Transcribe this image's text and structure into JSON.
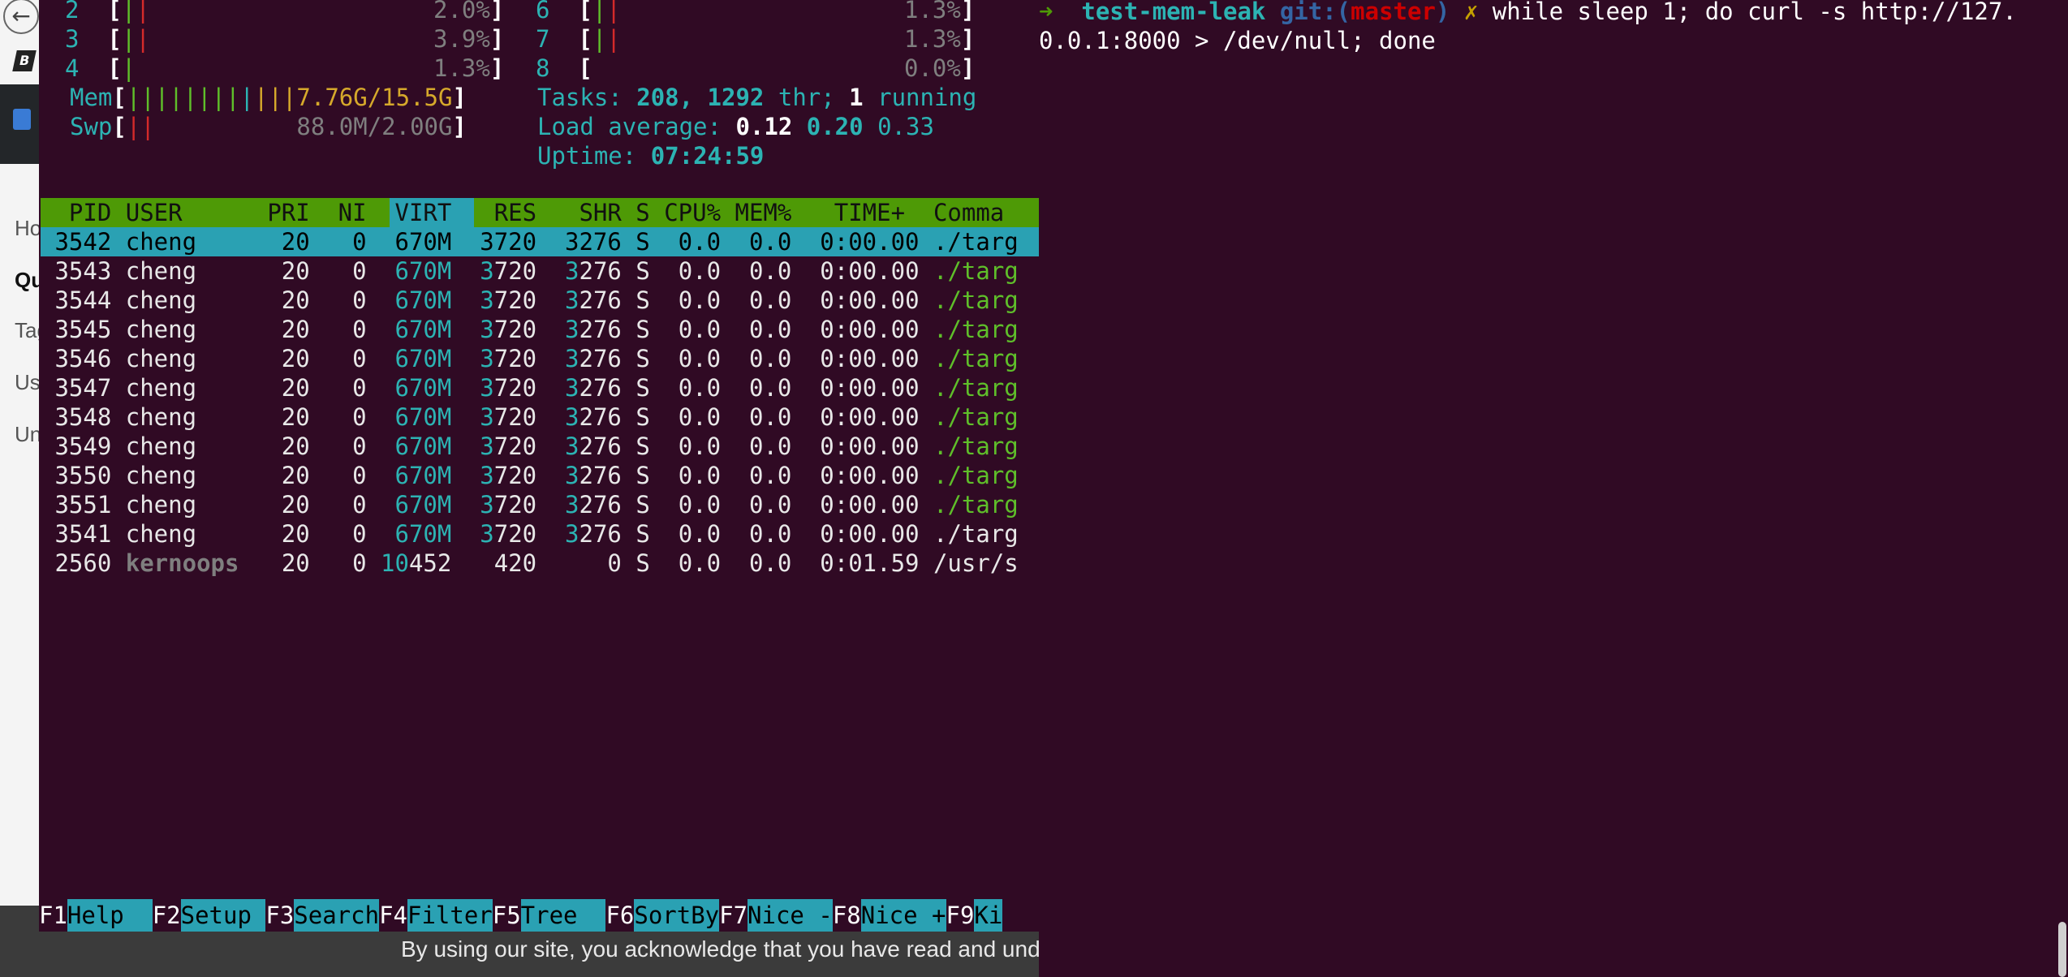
{
  "bg_page": {
    "back_glyph": "←",
    "logo_glyph": "B",
    "nav": [
      "Ho",
      "Qu",
      "Tag",
      "Us",
      "Un"
    ],
    "cookie_text": "By using our site, you acknowledge that you have read and understan"
  },
  "htop": {
    "cpus": [
      {
        "num": "2",
        "bars": "||",
        "pct": "2.0%"
      },
      {
        "num": "3",
        "bars": "||",
        "pct": "3.9%"
      },
      {
        "num": "4",
        "bars": "|",
        "pct": "1.3%"
      },
      {
        "num": "6",
        "bars": "||",
        "pct": "1.3%"
      },
      {
        "num": "7",
        "bars": "||",
        "pct": "1.3%"
      },
      {
        "num": "8",
        "bars": "",
        "pct": "0.0%"
      }
    ],
    "mem": {
      "label": "Mem",
      "bars": "||||||||||||",
      "value": "7.76G/15.5G"
    },
    "swp": {
      "label": "Swp",
      "bars": "||",
      "value": "88.0M/2.00G"
    },
    "tasks": {
      "label": "Tasks:",
      "tasks": "208,",
      "thr": "1292",
      "thr_label": "thr;",
      "running": "1",
      "running_label": "running"
    },
    "load": {
      "label": "Load average:",
      "v1": "0.12",
      "v2": "0.20",
      "v3": "0.33"
    },
    "uptime": {
      "label": "Uptime:",
      "value": "07:24:59"
    },
    "columns": "  PID USER      PRI  NI  VIRT   RES   SHR S CPU% MEM%   TIME+  Comma",
    "rows": [
      {
        "pid": "3542",
        "user": "cheng",
        "pri": "20",
        "ni": "0",
        "virt": "670M",
        "res": "3720",
        "shr": "3276",
        "s": "S",
        "cpu": "0.0",
        "mem": "0.0",
        "time": "0:00.00",
        "cmd": "./targ"
      },
      {
        "pid": "3543",
        "user": "cheng",
        "pri": "20",
        "ni": "0",
        "virt": "670M",
        "res": "3720",
        "shr": "3276",
        "s": "S",
        "cpu": "0.0",
        "mem": "0.0",
        "time": "0:00.00",
        "cmd": "./targ"
      },
      {
        "pid": "3544",
        "user": "cheng",
        "pri": "20",
        "ni": "0",
        "virt": "670M",
        "res": "3720",
        "shr": "3276",
        "s": "S",
        "cpu": "0.0",
        "mem": "0.0",
        "time": "0:00.00",
        "cmd": "./targ"
      },
      {
        "pid": "3545",
        "user": "cheng",
        "pri": "20",
        "ni": "0",
        "virt": "670M",
        "res": "3720",
        "shr": "3276",
        "s": "S",
        "cpu": "0.0",
        "mem": "0.0",
        "time": "0:00.00",
        "cmd": "./targ"
      },
      {
        "pid": "3546",
        "user": "cheng",
        "pri": "20",
        "ni": "0",
        "virt": "670M",
        "res": "3720",
        "shr": "3276",
        "s": "S",
        "cpu": "0.0",
        "mem": "0.0",
        "time": "0:00.00",
        "cmd": "./targ"
      },
      {
        "pid": "3547",
        "user": "cheng",
        "pri": "20",
        "ni": "0",
        "virt": "670M",
        "res": "3720",
        "shr": "3276",
        "s": "S",
        "cpu": "0.0",
        "mem": "0.0",
        "time": "0:00.00",
        "cmd": "./targ"
      },
      {
        "pid": "3548",
        "user": "cheng",
        "pri": "20",
        "ni": "0",
        "virt": "670M",
        "res": "3720",
        "shr": "3276",
        "s": "S",
        "cpu": "0.0",
        "mem": "0.0",
        "time": "0:00.00",
        "cmd": "./targ"
      },
      {
        "pid": "3549",
        "user": "cheng",
        "pri": "20",
        "ni": "0",
        "virt": "670M",
        "res": "3720",
        "shr": "3276",
        "s": "S",
        "cpu": "0.0",
        "mem": "0.0",
        "time": "0:00.00",
        "cmd": "./targ"
      },
      {
        "pid": "3550",
        "user": "cheng",
        "pri": "20",
        "ni": "0",
        "virt": "670M",
        "res": "3720",
        "shr": "3276",
        "s": "S",
        "cpu": "0.0",
        "mem": "0.0",
        "time": "0:00.00",
        "cmd": "./targ"
      },
      {
        "pid": "3551",
        "user": "cheng",
        "pri": "20",
        "ni": "0",
        "virt": "670M",
        "res": "3720",
        "shr": "3276",
        "s": "S",
        "cpu": "0.0",
        "mem": "0.0",
        "time": "0:00.00",
        "cmd": "./targ"
      },
      {
        "pid": "3541",
        "user": "cheng",
        "pri": "20",
        "ni": "0",
        "virt": "670M",
        "res": "3720",
        "shr": "3276",
        "s": "S",
        "cpu": "0.0",
        "mem": "0.0",
        "time": "0:00.00",
        "cmd": "./targ"
      },
      {
        "pid": "2560",
        "user": "kernoops",
        "pri": "20",
        "ni": "0",
        "virt": "10452",
        "res": "420",
        "shr": "0",
        "s": "S",
        "cpu": "0.0",
        "mem": "0.0",
        "time": "0:01.59",
        "cmd": "/usr/s"
      }
    ],
    "fkeys": [
      {
        "key": "F1",
        "label": "Help  "
      },
      {
        "key": "F2",
        "label": "Setup "
      },
      {
        "key": "F3",
        "label": "Search"
      },
      {
        "key": "F4",
        "label": "Filter"
      },
      {
        "key": "F5",
        "label": "Tree  "
      },
      {
        "key": "F6",
        "label": "SortBy"
      },
      {
        "key": "F7",
        "label": "Nice -"
      },
      {
        "key": "F8",
        "label": "Nice +"
      },
      {
        "key": "F9",
        "label": "Ki"
      }
    ]
  },
  "shell": {
    "arrow": "➜",
    "dir": "test-mem-leak",
    "git_label": "git:(",
    "branch": "master",
    "git_close": ")",
    "dirty": "✗",
    "command_line1": "while sleep 1; do curl -s http://127.",
    "command_line2": "0.0.1:8000 > /dev/null; done"
  },
  "colors": {
    "terminal_bg": "#300a24",
    "header_green": "#4e9a06",
    "highlight_teal": "#2aa1b3"
  }
}
